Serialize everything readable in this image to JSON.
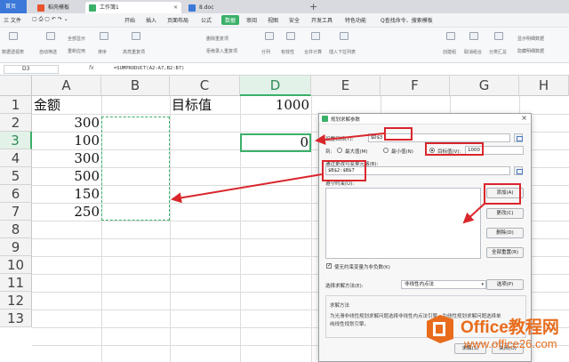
{
  "tabs": [
    {
      "label": "首页"
    },
    {
      "label": "稻壳模板"
    },
    {
      "label": "工作簿1"
    },
    {
      "label": "8.doc"
    }
  ],
  "menu": {
    "file": "三 文件",
    "items": [
      "开始",
      "插入",
      "页面布局",
      "公式",
      "数据",
      "审阅",
      "视图",
      "安全",
      "开发工具",
      "特色功能"
    ],
    "search": "Q查找命令、搜索模板"
  },
  "ribbon": {
    "items": [
      "数据透视表",
      "自动筛选",
      "全部显示",
      "重新应用",
      "排序",
      "高亮重复项",
      "删除重复项",
      "拒绝录入重复项",
      "分列",
      "有效性",
      "合并计算",
      "插入下拉列表",
      "创建组",
      "取消组合",
      "分类汇总",
      "显示明细数据",
      "隐藏明细数据"
    ]
  },
  "formula_bar": {
    "name_box": "D3",
    "fx": "fx",
    "formula": "=SUMPRODUCT(A2:A7,B2:B7)"
  },
  "sheet": {
    "columns": [
      "A",
      "B",
      "C",
      "D",
      "E",
      "F",
      "G",
      "H"
    ],
    "rows": [
      "1",
      "2",
      "3",
      "4",
      "5",
      "6",
      "7",
      "8",
      "9",
      "10",
      "11",
      "12",
      "13"
    ],
    "a1": "金额",
    "values": [
      "300",
      "100",
      "300",
      "500",
      "150",
      "250"
    ],
    "c1": "目标值",
    "d1": "1000",
    "d3": "0"
  },
  "dialog": {
    "title": "规划求解参数",
    "objective_label": "设置目标(T):",
    "objective_value": "$D$3",
    "to_label": "到:",
    "opt_max": "最大值(M)",
    "opt_min": "最小值(N)",
    "opt_target": "目标值(V):",
    "target_value": "1000",
    "variable_label": "通过更改可变单元格(B):",
    "variable_value": "$B$2:$B$7",
    "constraints_label": "遵守约束(U):",
    "btn_add": "添加(A)",
    "btn_change": "更改(C)",
    "btn_delete": "删除(D)",
    "btn_reset": "全部重置(R)",
    "nonneg_label": "使无约束变量为非负数(K)",
    "method_label": "选择求解方法(E):",
    "method_value": "非线性内点法",
    "btn_options": "选项(P)",
    "desc_title": "求解方法",
    "desc_line1": "为光滑非线性规划求解问题选择非线性内点法引擎。为线性规划求解问题选择单",
    "desc_line2": "纯线性规划引擎。",
    "btn_solve": "求解(S)",
    "btn_close": "关闭(O)"
  },
  "watermark": {
    "line1": "Office教程网",
    "line2": "www.office26.com"
  },
  "colors": {
    "accent_green": "#3ab069",
    "annotation_red": "#d9262b",
    "watermark_orange": "#e86c1c",
    "tab_home_blue": "#3b78d8"
  }
}
